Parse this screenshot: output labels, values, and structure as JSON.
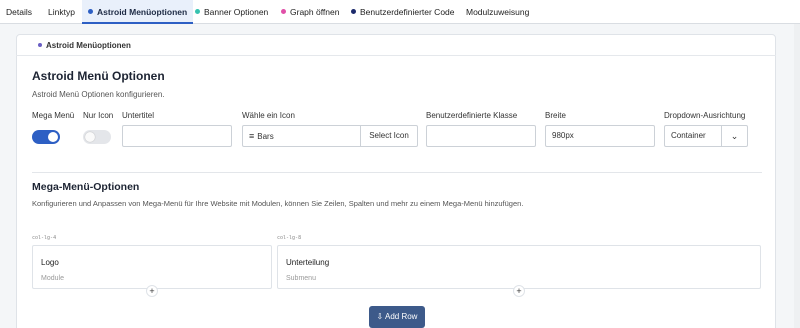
{
  "tabs": [
    {
      "label": "Details",
      "dot": ""
    },
    {
      "label": "Linktyp",
      "dot": ""
    },
    {
      "label": "Astroid Menüoptionen",
      "dot": "#2d5fc4"
    },
    {
      "label": "Banner Optionen",
      "dot": "#35c2b0"
    },
    {
      "label": "Graph öffnen",
      "dot": "#e04fa8"
    },
    {
      "label": "Benutzerdefinierter Code",
      "dot": "#1c2a6b"
    },
    {
      "label": "Modulzuweisung",
      "dot": ""
    }
  ],
  "panel": {
    "tag": "Astroid Menüoptionen",
    "title": "Astroid Menü Optionen",
    "description": "Astroid Menü Optionen konfigurieren."
  },
  "fields": {
    "mega_menu": {
      "label": "Mega Menü",
      "value": true
    },
    "nur_icon": {
      "label": "Nur Icon",
      "value": false
    },
    "untertitel": {
      "label": "Untertitel",
      "value": ""
    },
    "icon": {
      "label": "Wähle ein Icon",
      "value": "Bars",
      "button": "Select Icon"
    },
    "klasse": {
      "label": "Benutzerdefinierte Klasse",
      "value": ""
    },
    "breite": {
      "label": "Breite",
      "value": "980px"
    },
    "dropdown": {
      "label": "Dropdown-Ausrichtung",
      "value": "Container"
    }
  },
  "mega": {
    "title": "Mega-Menü-Optionen",
    "description": "Konfigurieren und Anpassen von Mega-Menü für Ihre Website mit Modulen, können Sie Zeilen, Spalten und mehr zu einem Mega-Menü hinzufügen.",
    "columns": [
      {
        "code": "col-lg-4",
        "title": "Logo",
        "subtitle": "Module"
      },
      {
        "code": "col-lg-8",
        "title": "Unterteilung",
        "subtitle": "Submenu"
      }
    ],
    "add_row": "Add Row"
  },
  "colors": {
    "accent": "#2d5fc4",
    "button": "#3d5a8a"
  }
}
